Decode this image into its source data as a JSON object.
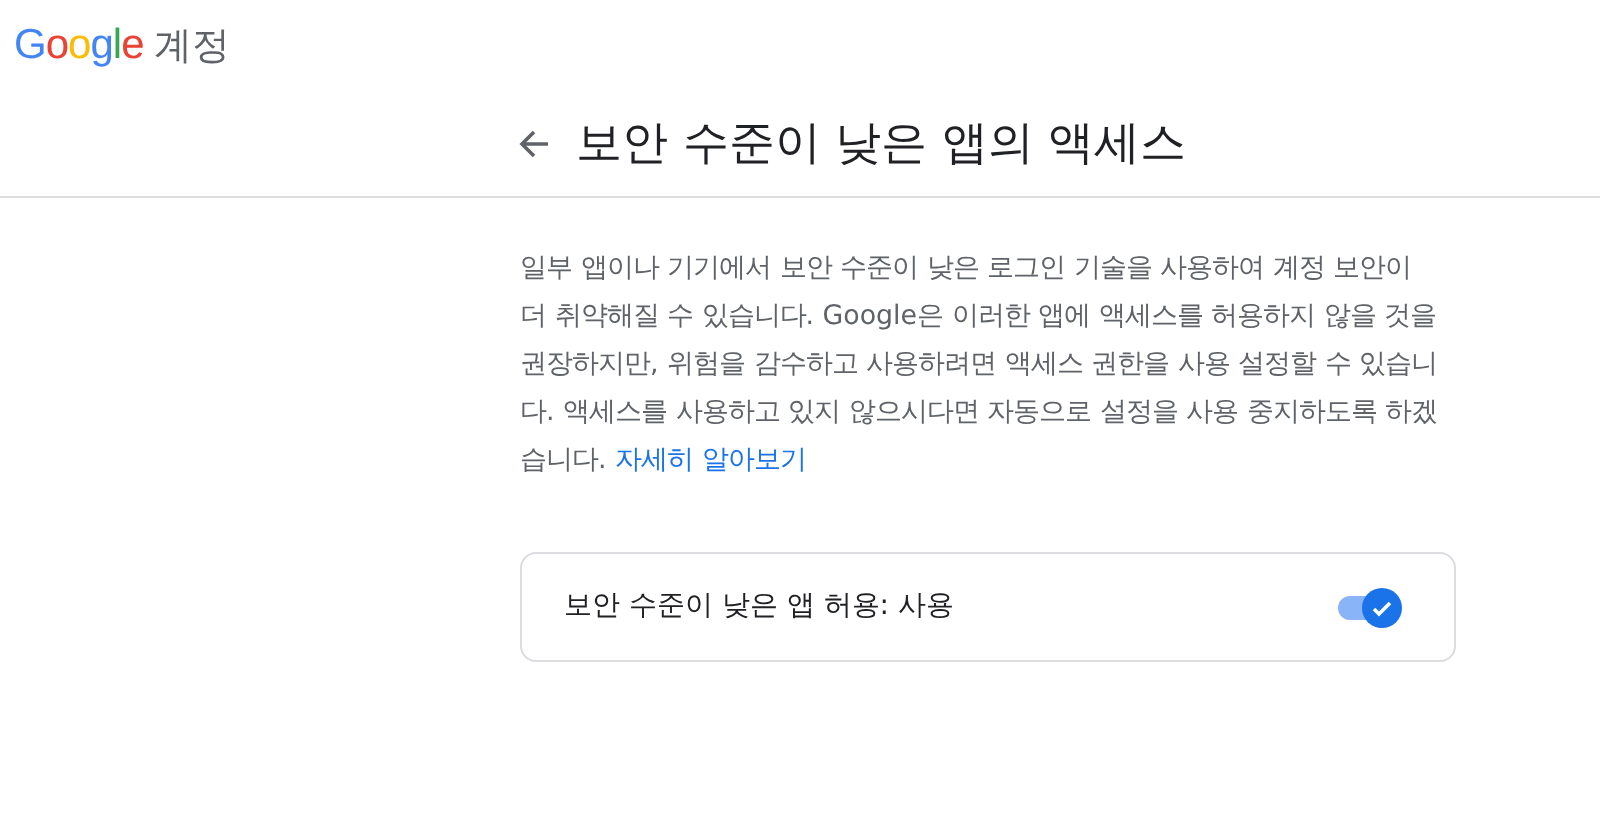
{
  "header": {
    "brand": "Google",
    "product": "계정"
  },
  "page": {
    "title": "보안 수준이 낮은 앱의 액세스"
  },
  "description": {
    "text": "일부 앱이나 기기에서 보안 수준이 낮은 로그인 기술을 사용하여 계정 보안이 더 취약해질 수 있습니다. Google은 이러한 앱에 액세스를 허용하지 않을 것을 권장하지만, 위험을 감수하고 사용하려면 액세스 권한을 사용 설정할 수 있습니다. 액세스를 사용하고 있지 않으시다면 자동으로 설정을 사용 중지하도록 하겠습니다.",
    "link": "자세히 알아보기"
  },
  "setting": {
    "label": "보안 수준이 낮은 앱 허용: 사용",
    "on": true
  }
}
